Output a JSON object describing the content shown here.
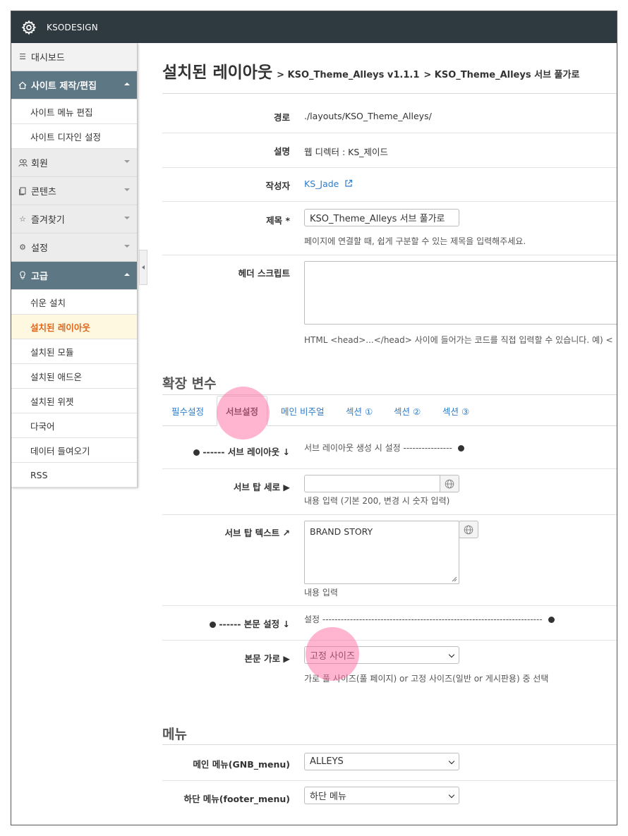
{
  "app": {
    "brand": "KSODESIGN",
    "icon": "gear-icon"
  },
  "sidebar": {
    "dashboard": "대시보드",
    "site": {
      "label": "사이트 제작/편집",
      "items": [
        "사이트 메뉴 편집",
        "사이트 디자인 설정"
      ]
    },
    "member": "회원",
    "content": "콘텐츠",
    "favorites": "즐겨찾기",
    "settings": "설정",
    "advanced": {
      "label": "고급",
      "items": [
        "쉬운 설치",
        "설치된 레이아웃",
        "설치된 모듈",
        "설치된 애드온",
        "설치된 위젯",
        "다국어",
        "데이터 들여오기",
        "RSS"
      ]
    }
  },
  "page": {
    "title": "설치된 레이아웃",
    "crumb1": "> KSO_Theme_Alleys v1.1.1",
    "crumb2": "> KSO_Theme_Alleys 서브 풀가로"
  },
  "info": {
    "path_label": "경로",
    "path_value": "./layouts/KSO_Theme_Alleys/",
    "desc_label": "설명",
    "desc_value": "웹 디렉터 : KS_제이드",
    "author_label": "작성자",
    "author_value": "KS_Jade",
    "title_label": "제목 *",
    "title_value": "KSO_Theme_Alleys 서브 풀가로",
    "title_help": "페이지에 연결할 때, 쉽게 구분할 수 있는 제목을 입력해주세요.",
    "header_label": "헤더 스크립트",
    "header_help": "HTML <head>...</head> 사이에 들어가는 코드를 직접 입력할 수 있습니다. 예) <"
  },
  "ext": {
    "title": "확장 변수",
    "tabs": [
      "필수설정",
      "서브설정",
      "메인 비주얼",
      "섹션 ①",
      "섹션 ②",
      "섹션 ③"
    ],
    "sub_layout_label": "------ 서브 레이아웃 ↓",
    "sub_layout_text": "서브 레이아웃 생성 시 설정 ----------------",
    "sub_top_height_label": "서브 탑 세로 ▶",
    "sub_top_height_value": "",
    "sub_top_height_help": "내용 입력 (기본 200, 변경 시 숫자 입력)",
    "sub_top_text_label": "서브 탑 텍스트 ↗",
    "sub_top_text_value": "BRAND STORY",
    "sub_top_text_help": "내용 입력",
    "body_setting_label": "------ 본문 설정 ↓",
    "body_setting_text": "설정 ------------------------------------------------------------------------",
    "body_width_label": "본문 가로 ▶",
    "body_width_value": "고정 사이즈",
    "body_width_help": "가로 풀 사이즈(풀 페이지) or 고정 사이즈(일반 or 게시판용) 중 선택"
  },
  "menu": {
    "title": "메뉴",
    "main_label": "메인 메뉴(GNB_menu)",
    "main_value": "ALLEYS",
    "footer_label": "하단 메뉴(footer_menu)",
    "footer_value": "하단 메뉴"
  },
  "colors": {
    "topbar": "#2f3940",
    "active_nav": "#5d7784",
    "link": "#2f7cc8",
    "current_item": "#e0671b",
    "highlight": "#ff69a0"
  }
}
